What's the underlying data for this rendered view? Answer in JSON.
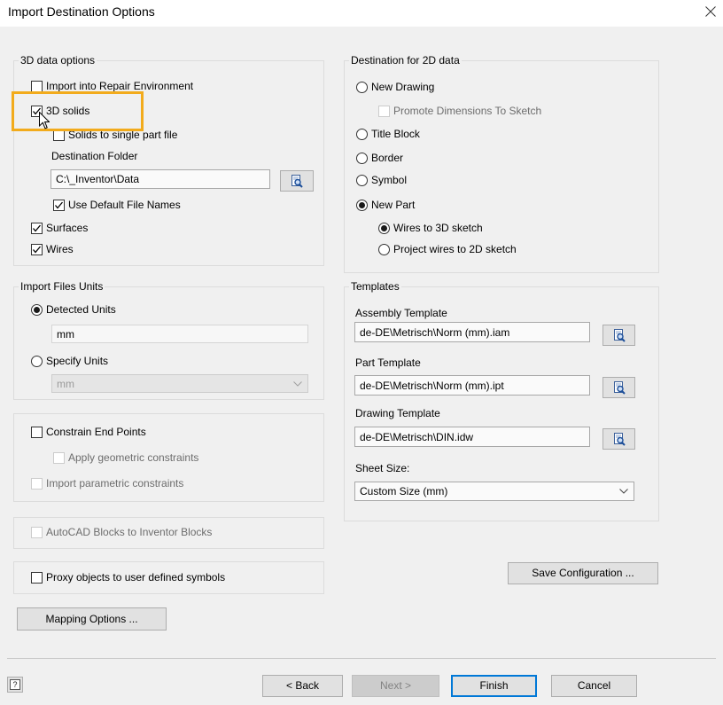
{
  "theme": {
    "bg": "#f0f0f0",
    "accent": "#0078d7",
    "highlight": "#f2ab1c",
    "disabled_text": "#6d6d6d"
  },
  "window": {
    "title": "Import Destination Options",
    "close_icon": "close-icon"
  },
  "data3d": {
    "title": "3D data options",
    "import_repair": {
      "label": "Import into Repair Environment",
      "checked": false
    },
    "solids": {
      "label": "3D solids",
      "checked": true,
      "highlighted": true
    },
    "solids_single": {
      "label": "Solids to single part file",
      "checked": false
    },
    "dest_folder": {
      "label": "Destination Folder",
      "value": "C:\\_Inventor\\Data",
      "browse_icon": "browse-icon"
    },
    "use_default_names": {
      "label": "Use Default File Names",
      "checked": true
    },
    "surfaces": {
      "label": "Surfaces",
      "checked": true
    },
    "wires": {
      "label": "Wires",
      "checked": true
    }
  },
  "units": {
    "title": "Import Files Units",
    "detected": {
      "label": "Detected Units",
      "selected": true
    },
    "detected_value": "mm",
    "specify": {
      "label": "Specify Units",
      "selected": false
    },
    "specify_dropdown": {
      "value": "mm",
      "disabled": true,
      "icon": "chevron-down-icon"
    }
  },
  "constraints": {
    "constrain_end_points": {
      "label": "Constrain End Points",
      "checked": false
    },
    "apply_geometric": {
      "label": "Apply geometric constraints",
      "checked": false,
      "disabled": true
    },
    "import_parametric": {
      "label": "Import parametric constraints",
      "checked": false,
      "disabled": true
    }
  },
  "blocks": {
    "label": "AutoCAD Blocks to Inventor Blocks",
    "checked": false,
    "disabled": true
  },
  "proxy": {
    "label": "Proxy objects to user defined symbols",
    "checked": false
  },
  "mapping_button": "Mapping Options ...",
  "dest2d": {
    "title": "Destination for 2D data",
    "new_drawing": {
      "label": "New Drawing",
      "selected": false
    },
    "promote_dimensions": {
      "label": "Promote Dimensions To Sketch",
      "checked": false,
      "disabled": true
    },
    "title_block": {
      "label": "Title Block",
      "selected": false
    },
    "border": {
      "label": "Border",
      "selected": false
    },
    "symbol": {
      "label": "Symbol",
      "selected": false
    },
    "new_part": {
      "label": "New Part",
      "selected": true
    },
    "wires_3d": {
      "label": "Wires to 3D sketch",
      "selected": true
    },
    "wires_2d": {
      "label": "Project wires to 2D sketch",
      "selected": false
    }
  },
  "templates": {
    "title": "Templates",
    "assembly": {
      "label": "Assembly Template",
      "value": "de-DE\\Metrisch\\Norm (mm).iam"
    },
    "part": {
      "label": "Part Template",
      "value": "de-DE\\Metrisch\\Norm (mm).ipt"
    },
    "drawing": {
      "label": "Drawing Template",
      "value": "de-DE\\Metrisch\\DIN.idw"
    },
    "sheet_size": {
      "label": "Sheet Size:",
      "value": "Custom Size (mm)",
      "icon": "chevron-down-icon"
    }
  },
  "save_config_button": "Save Configuration ...",
  "footer": {
    "help_label": "?",
    "back": {
      "label": "< Back",
      "disabled": false
    },
    "next": {
      "label": "Next >",
      "disabled": true
    },
    "finish": {
      "label": "Finish",
      "default": true
    },
    "cancel": {
      "label": "Cancel"
    }
  },
  "overlay": {
    "cursor_icon": "mouse-cursor-icon"
  }
}
